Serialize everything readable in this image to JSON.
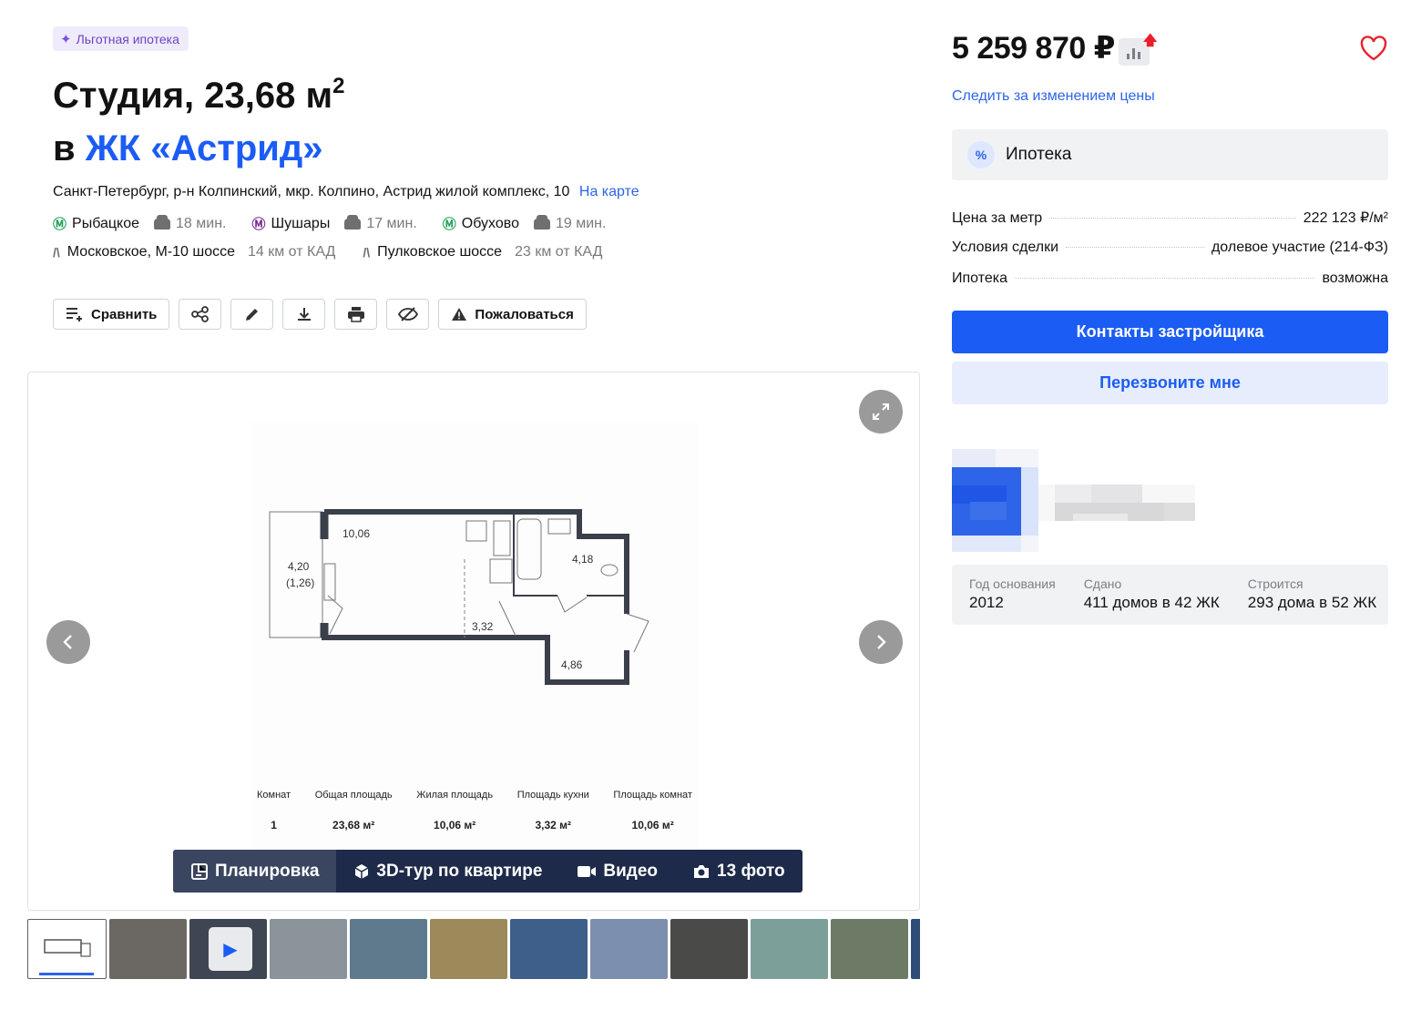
{
  "badge": {
    "label": "Льготная ипотека"
  },
  "title": {
    "line1": "Студия, 23,68 м",
    "line1_sup": "2",
    "prefix": "в",
    "complex": "ЖК «Астрид»"
  },
  "address": {
    "text": "Санкт-Петербург, р-н Колпинский, мкр. Колпино, Астрид жилой комплекс, 10",
    "map_link": "На карте"
  },
  "metro": [
    {
      "name": "Рыбацкое",
      "time": "18 мин.",
      "color": "#23a35a"
    },
    {
      "name": "Шушары",
      "time": "17 мин.",
      "color": "#7b2b91"
    },
    {
      "name": "Обухово",
      "time": "19 мин.",
      "color": "#23a35a"
    }
  ],
  "roads": [
    {
      "name": "Московское, М-10 шоссе",
      "distance": "14 км от КАД"
    },
    {
      "name": "Пулковское шоссе",
      "distance": "23 км от КАД"
    }
  ],
  "toolbar": {
    "compare": "Сравнить",
    "report": "Пожаловаться"
  },
  "plan": {
    "rooms": [
      "10,06",
      "4,20",
      "(1,26)",
      "4,18",
      "3,32",
      "4,86"
    ],
    "stats": [
      {
        "label": "Комнат",
        "value": "1"
      },
      {
        "label": "Общая площадь",
        "value": "23,68 м²"
      },
      {
        "label": "Жилая площадь",
        "value": "10,06 м²"
      },
      {
        "label": "Площадь кухни",
        "value": "3,32 м²"
      },
      {
        "label": "Площадь комнат",
        "value": "10,06 м²"
      }
    ]
  },
  "media_tabs": {
    "plan": "Планировка",
    "tour": "3D-тур по квартире",
    "video": "Видео",
    "photos": "13 фото"
  },
  "thumbs": [
    {
      "kind": "plan",
      "bg": "#ffffff"
    },
    {
      "kind": "photo",
      "bg": "#6b6763"
    },
    {
      "kind": "video",
      "bg": "#3f4653"
    },
    {
      "kind": "photo",
      "bg": "#8a949a"
    },
    {
      "kind": "photo",
      "bg": "#5f7a8c"
    },
    {
      "kind": "photo",
      "bg": "#9c8a5a"
    },
    {
      "kind": "photo",
      "bg": "#3d5f8a"
    },
    {
      "kind": "photo",
      "bg": "#7d8fae"
    },
    {
      "kind": "photo",
      "bg": "#4a4b48"
    },
    {
      "kind": "photo",
      "bg": "#7d9f9a"
    },
    {
      "kind": "photo",
      "bg": "#6c7a66"
    },
    {
      "kind": "photo",
      "bg": "#2e4c7a"
    }
  ],
  "price": {
    "value": "5 259 870 ₽",
    "watch": "Следить за изменением цены",
    "trend_color": "#ea1d2c"
  },
  "mortgage": {
    "label": "Ипотека"
  },
  "props": [
    {
      "label": "Цена за метр",
      "value": "222 123 ₽/м²"
    },
    {
      "label": "Условия сделки",
      "value": "долевое участие (214-ФЗ)"
    },
    {
      "label": "Ипотека",
      "value": "возможна"
    }
  ],
  "buttons": {
    "contacts": "Контакты застройщика",
    "callback": "Перезвоните мне"
  },
  "developer": {
    "founded_label": "Год основания",
    "founded": "2012",
    "done_label": "Сдано",
    "done": "411 домов в 42 ЖК",
    "building_label": "Строится",
    "building": "293 дома в 52 ЖК"
  },
  "colors": {
    "accent": "#1b5cf5",
    "accent_light": "#e7edfc",
    "panel": "#f1f2f4",
    "media_bar": "#1d2a49"
  }
}
